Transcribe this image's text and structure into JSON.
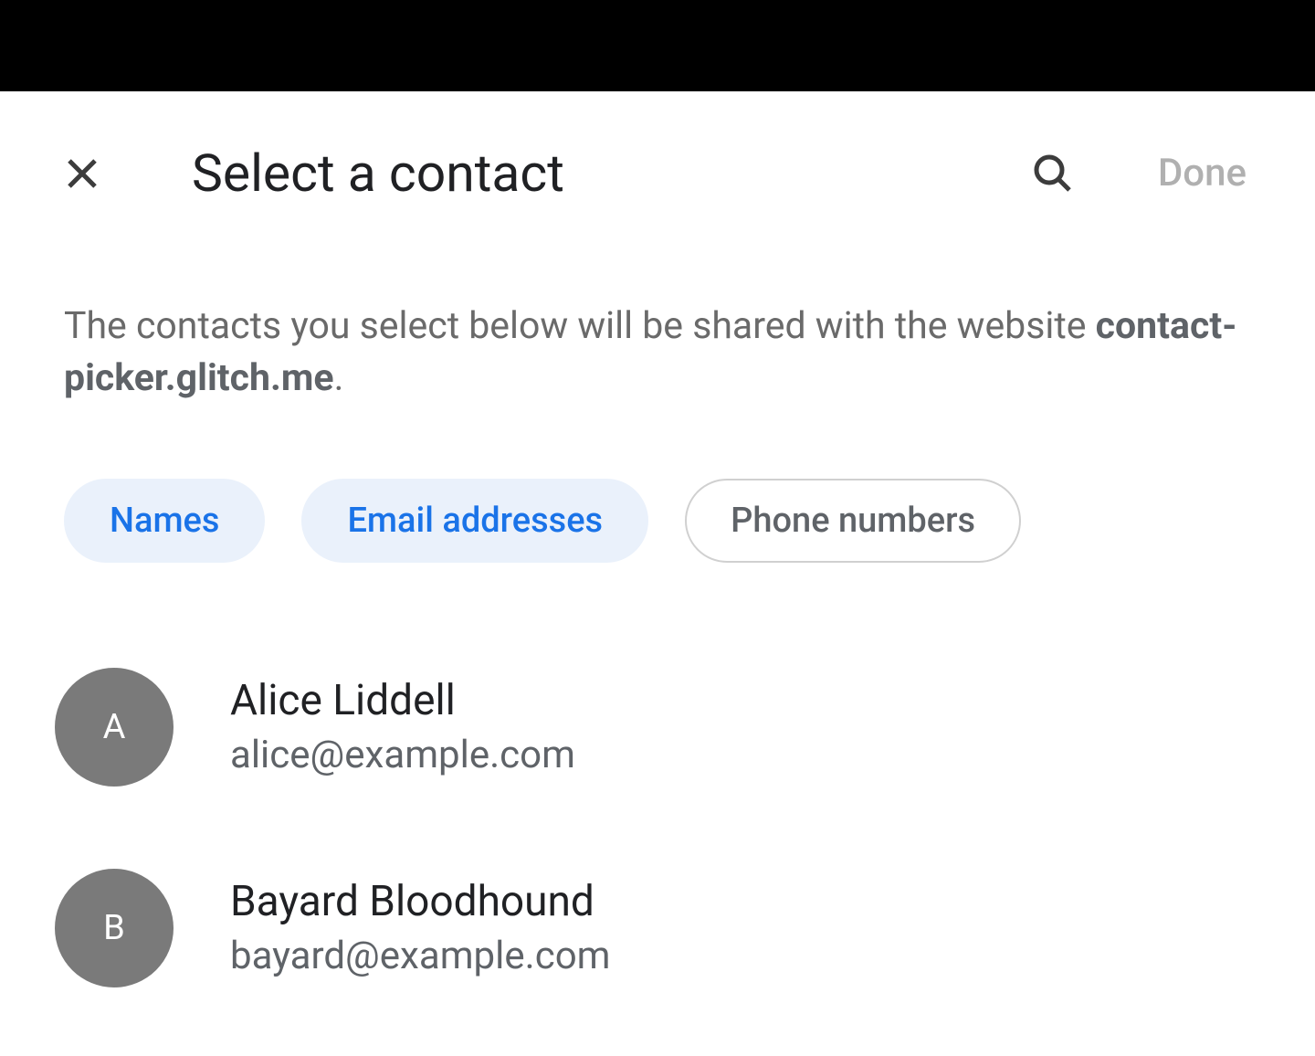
{
  "header": {
    "title": "Select a contact",
    "done_label": "Done"
  },
  "description": {
    "text_before": "The contacts you select below will be shared with the website ",
    "website": "contact-picker.glitch.me",
    "text_after": "."
  },
  "chips": [
    {
      "label": "Names",
      "active": true
    },
    {
      "label": "Email addresses",
      "active": true
    },
    {
      "label": "Phone numbers",
      "active": false
    }
  ],
  "contacts": [
    {
      "initial": "A",
      "name": "Alice Liddell",
      "email": "alice@example.com"
    },
    {
      "initial": "B",
      "name": "Bayard Bloodhound",
      "email": "bayard@example.com"
    }
  ]
}
